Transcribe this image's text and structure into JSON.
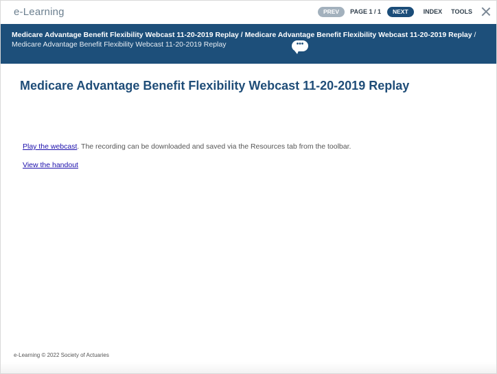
{
  "app": {
    "title": "e-Learning"
  },
  "nav": {
    "prev_label": "PREV",
    "page_label": "PAGE 1 / 1",
    "next_label": "NEXT",
    "index_label": "INDEX",
    "tools_label": "TOOLS",
    "close_icon": "close-icon"
  },
  "breadcrumb": {
    "crumb1": "Medicare Advantage Benefit Flexibility Webcast 11-20-2019 Replay",
    "separator1": " / ",
    "crumb2": "Medicare Advantage Benefit Flexibility Webcast 11-20-2019 Replay",
    "separator2": " / ",
    "crumb3": "Medicare Advantage Benefit Flexibility Webcast 11-20-2019 Replay",
    "chat_icon_glyph": "•••"
  },
  "main": {
    "title": "Medicare Advantage Benefit Flexibility Webcast 11-20-2019 Replay",
    "play_link": "Play the webcast",
    "play_description": ". The recording can be downloaded and saved via the Resources tab from the toolbar.",
    "handout_link": "View the handout"
  },
  "footer": {
    "text": "e-Learning © 2022 Society of Actuaries"
  },
  "colors": {
    "header_bg": "#1d4f7a",
    "title_color": "#1f4d78",
    "next_pill": "#1b4d79",
    "prev_pill": "#a3b1bd",
    "link": "#1a0dab"
  }
}
